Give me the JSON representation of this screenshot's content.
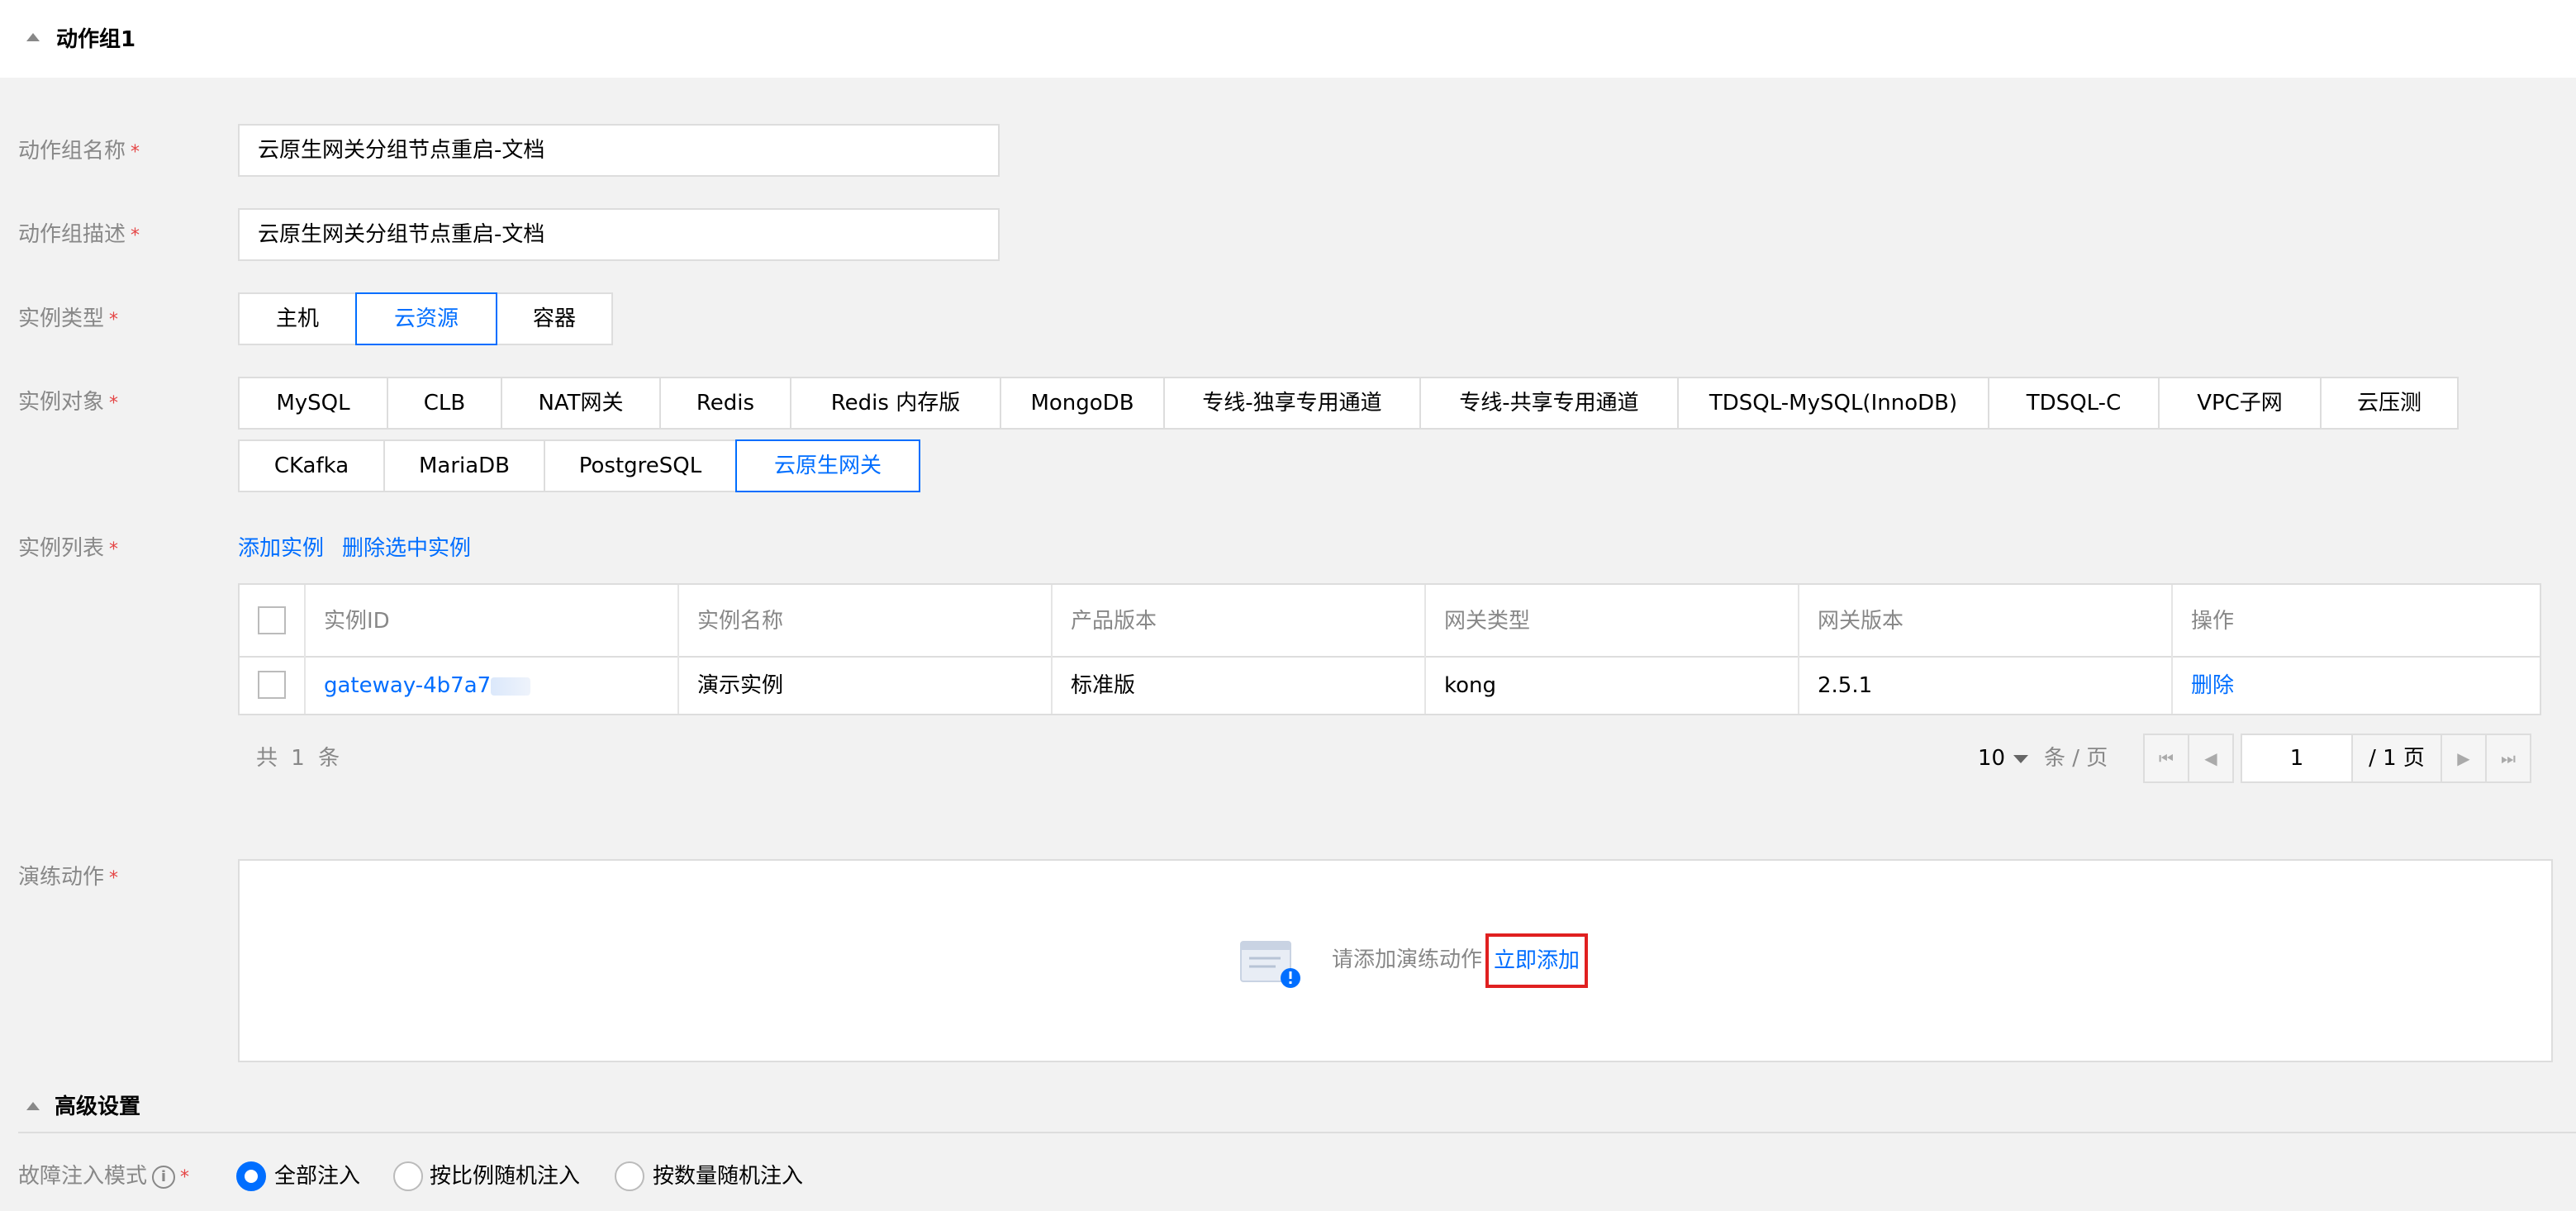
{
  "section": {
    "title": "动作组1"
  },
  "form": {
    "name_label": "动作组名称",
    "name_value": "云原生网关分组节点重启-文档",
    "desc_label": "动作组描述",
    "desc_value": "云原生网关分组节点重启-文档",
    "required_mark": "*",
    "instance_type_label": "实例类型",
    "instance_types": [
      "主机",
      "云资源",
      "容器"
    ],
    "instance_type_selected": "云资源",
    "instance_object_label": "实例对象",
    "instance_objects_row1": [
      "MySQL",
      "CLB",
      "NAT网关",
      "Redis",
      "Redis 内存版",
      "MongoDB",
      "专线-独享专用通道",
      "专线-共享专用通道",
      "TDSQL-MySQL(InnoDB)",
      "TDSQL-C",
      "VPC子网",
      "云压测"
    ],
    "instance_objects_row2": [
      "CKafka",
      "MariaDB",
      "PostgreSQL",
      "云原生网关"
    ],
    "instance_object_selected": "云原生网关",
    "instance_list_label": "实例列表",
    "add_instance": "添加实例",
    "delete_selected": "删除选中实例"
  },
  "table": {
    "headers": [
      "实例ID",
      "实例名称",
      "产品版本",
      "网关类型",
      "网关版本",
      "操作"
    ],
    "rows": [
      {
        "id": "gateway-4b7a7",
        "name": "演示实例",
        "version": "标准版",
        "gateway_type": "kong",
        "gateway_version": "2.5.1",
        "action": "删除"
      }
    ]
  },
  "pagination": {
    "total": "共 1 条",
    "page_size": "10",
    "per_page": "条 / 页",
    "current_page": "1",
    "total_pages": "/ 1 页"
  },
  "drill": {
    "label": "演练动作",
    "empty_text": "请添加演练动作",
    "add_now": "立即添加"
  },
  "advanced": {
    "title": "高级设置",
    "fault_mode_label": "故障注入模式",
    "info_icon_glyph": "i",
    "options": [
      "全部注入",
      "按比例随机注入",
      "按数量随机注入"
    ],
    "selected": "全部注入"
  },
  "colors": {
    "accent": "#006eff",
    "required": "#e54545",
    "highlight_border": "#e02020"
  },
  "icons": [
    "caret-up-icon",
    "checkbox-icon",
    "chevron-down-icon",
    "first-page-icon",
    "prev-page-icon",
    "next-page-icon",
    "last-page-icon",
    "empty-document-icon",
    "info-icon"
  ]
}
